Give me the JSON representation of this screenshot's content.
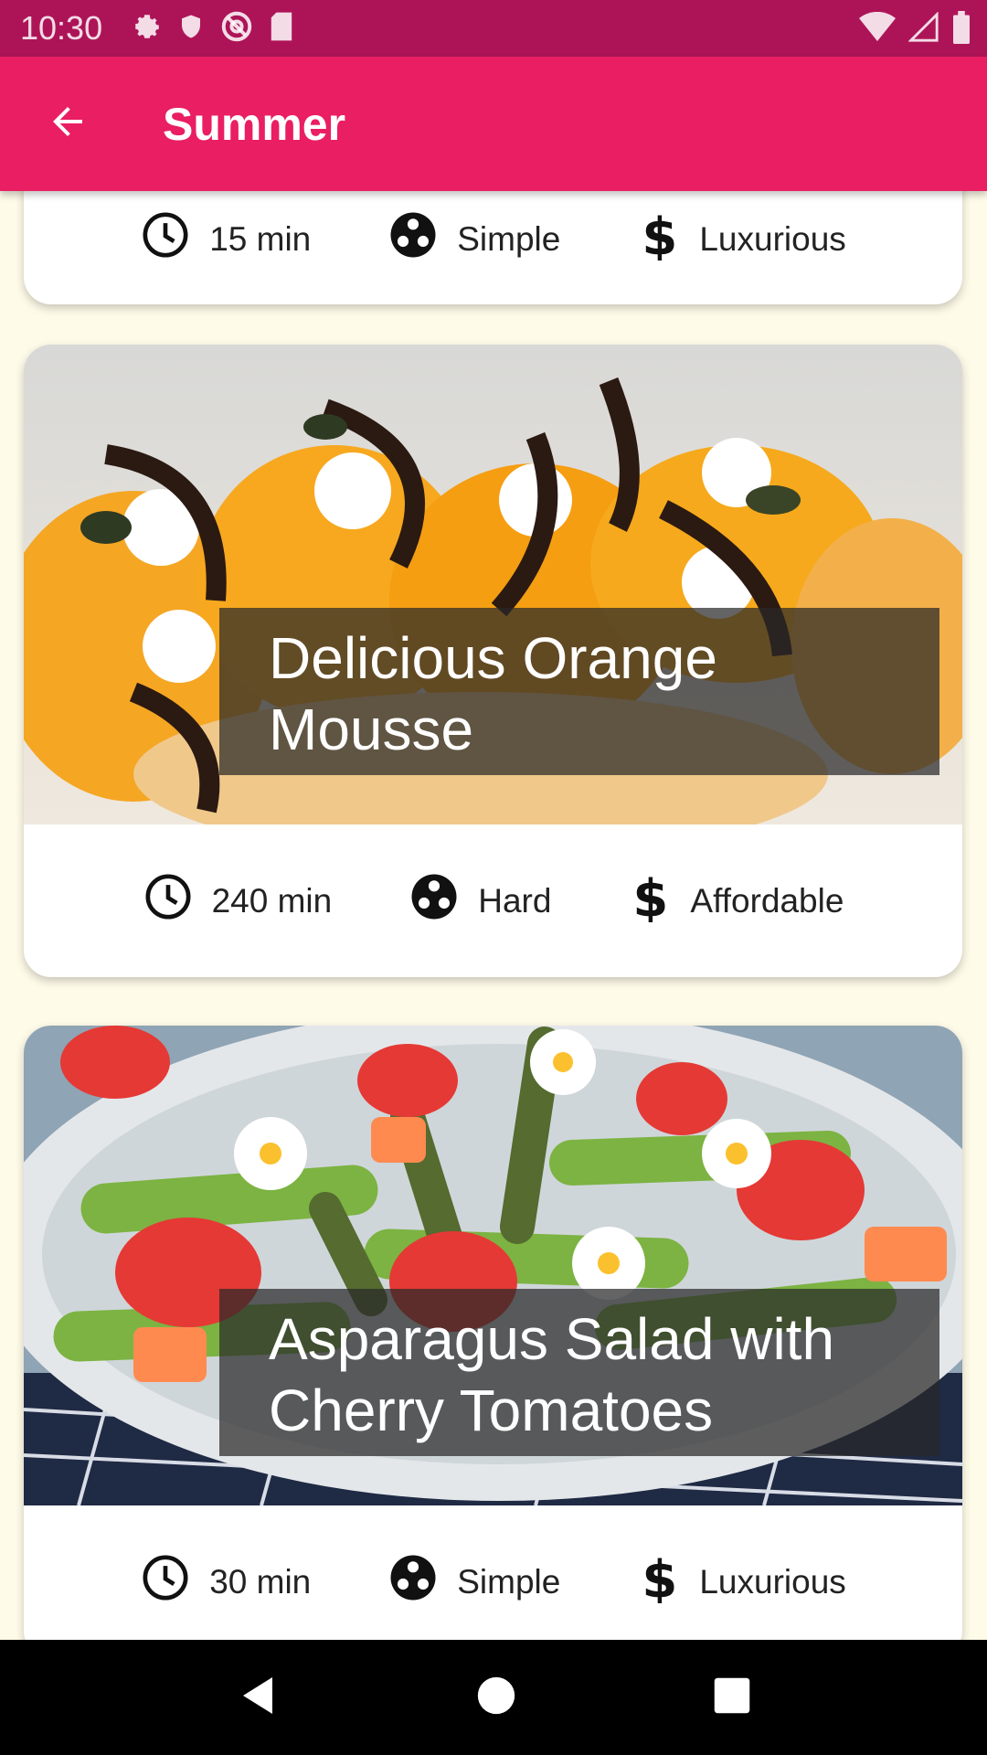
{
  "status_bar": {
    "time": "10:30"
  },
  "app_bar": {
    "title": "Summer"
  },
  "meals": [
    {
      "title": "",
      "duration": "15 min",
      "complexity": "Simple",
      "affordability": "Luxurious"
    },
    {
      "title": "Delicious Orange Mousse",
      "duration": "240 min",
      "complexity": "Hard",
      "affordability": "Affordable"
    },
    {
      "title": "Asparagus Salad with Cherry Tomatoes",
      "duration": "30 min",
      "complexity": "Simple",
      "affordability": "Luxurious"
    }
  ],
  "colors": {
    "status_bar": "#ad1457",
    "app_bar": "#e91e63",
    "background": "#fffbe9"
  }
}
